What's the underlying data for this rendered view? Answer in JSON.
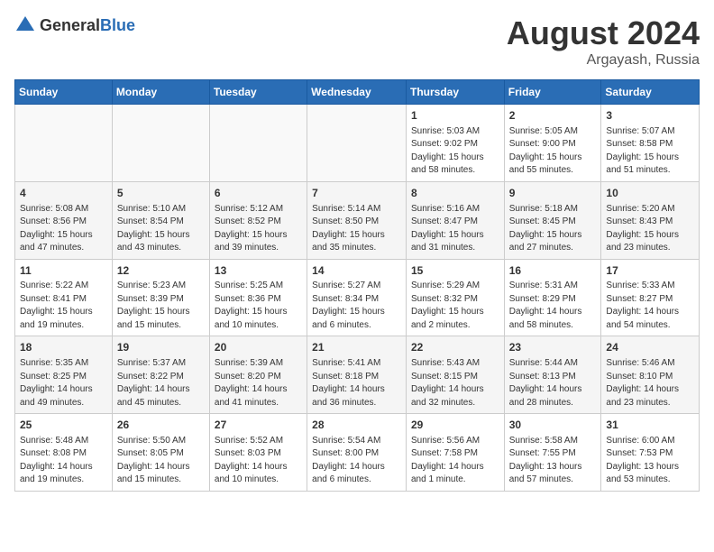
{
  "header": {
    "logo_general": "General",
    "logo_blue": "Blue",
    "month_year": "August 2024",
    "location": "Argayash, Russia"
  },
  "weekdays": [
    "Sunday",
    "Monday",
    "Tuesday",
    "Wednesday",
    "Thursday",
    "Friday",
    "Saturday"
  ],
  "weeks": [
    [
      {
        "day": "",
        "info": ""
      },
      {
        "day": "",
        "info": ""
      },
      {
        "day": "",
        "info": ""
      },
      {
        "day": "",
        "info": ""
      },
      {
        "day": "1",
        "info": "Sunrise: 5:03 AM\nSunset: 9:02 PM\nDaylight: 15 hours\nand 58 minutes."
      },
      {
        "day": "2",
        "info": "Sunrise: 5:05 AM\nSunset: 9:00 PM\nDaylight: 15 hours\nand 55 minutes."
      },
      {
        "day": "3",
        "info": "Sunrise: 5:07 AM\nSunset: 8:58 PM\nDaylight: 15 hours\nand 51 minutes."
      }
    ],
    [
      {
        "day": "4",
        "info": "Sunrise: 5:08 AM\nSunset: 8:56 PM\nDaylight: 15 hours\nand 47 minutes."
      },
      {
        "day": "5",
        "info": "Sunrise: 5:10 AM\nSunset: 8:54 PM\nDaylight: 15 hours\nand 43 minutes."
      },
      {
        "day": "6",
        "info": "Sunrise: 5:12 AM\nSunset: 8:52 PM\nDaylight: 15 hours\nand 39 minutes."
      },
      {
        "day": "7",
        "info": "Sunrise: 5:14 AM\nSunset: 8:50 PM\nDaylight: 15 hours\nand 35 minutes."
      },
      {
        "day": "8",
        "info": "Sunrise: 5:16 AM\nSunset: 8:47 PM\nDaylight: 15 hours\nand 31 minutes."
      },
      {
        "day": "9",
        "info": "Sunrise: 5:18 AM\nSunset: 8:45 PM\nDaylight: 15 hours\nand 27 minutes."
      },
      {
        "day": "10",
        "info": "Sunrise: 5:20 AM\nSunset: 8:43 PM\nDaylight: 15 hours\nand 23 minutes."
      }
    ],
    [
      {
        "day": "11",
        "info": "Sunrise: 5:22 AM\nSunset: 8:41 PM\nDaylight: 15 hours\nand 19 minutes."
      },
      {
        "day": "12",
        "info": "Sunrise: 5:23 AM\nSunset: 8:39 PM\nDaylight: 15 hours\nand 15 minutes."
      },
      {
        "day": "13",
        "info": "Sunrise: 5:25 AM\nSunset: 8:36 PM\nDaylight: 15 hours\nand 10 minutes."
      },
      {
        "day": "14",
        "info": "Sunrise: 5:27 AM\nSunset: 8:34 PM\nDaylight: 15 hours\nand 6 minutes."
      },
      {
        "day": "15",
        "info": "Sunrise: 5:29 AM\nSunset: 8:32 PM\nDaylight: 15 hours\nand 2 minutes."
      },
      {
        "day": "16",
        "info": "Sunrise: 5:31 AM\nSunset: 8:29 PM\nDaylight: 14 hours\nand 58 minutes."
      },
      {
        "day": "17",
        "info": "Sunrise: 5:33 AM\nSunset: 8:27 PM\nDaylight: 14 hours\nand 54 minutes."
      }
    ],
    [
      {
        "day": "18",
        "info": "Sunrise: 5:35 AM\nSunset: 8:25 PM\nDaylight: 14 hours\nand 49 minutes."
      },
      {
        "day": "19",
        "info": "Sunrise: 5:37 AM\nSunset: 8:22 PM\nDaylight: 14 hours\nand 45 minutes."
      },
      {
        "day": "20",
        "info": "Sunrise: 5:39 AM\nSunset: 8:20 PM\nDaylight: 14 hours\nand 41 minutes."
      },
      {
        "day": "21",
        "info": "Sunrise: 5:41 AM\nSunset: 8:18 PM\nDaylight: 14 hours\nand 36 minutes."
      },
      {
        "day": "22",
        "info": "Sunrise: 5:43 AM\nSunset: 8:15 PM\nDaylight: 14 hours\nand 32 minutes."
      },
      {
        "day": "23",
        "info": "Sunrise: 5:44 AM\nSunset: 8:13 PM\nDaylight: 14 hours\nand 28 minutes."
      },
      {
        "day": "24",
        "info": "Sunrise: 5:46 AM\nSunset: 8:10 PM\nDaylight: 14 hours\nand 23 minutes."
      }
    ],
    [
      {
        "day": "25",
        "info": "Sunrise: 5:48 AM\nSunset: 8:08 PM\nDaylight: 14 hours\nand 19 minutes."
      },
      {
        "day": "26",
        "info": "Sunrise: 5:50 AM\nSunset: 8:05 PM\nDaylight: 14 hours\nand 15 minutes."
      },
      {
        "day": "27",
        "info": "Sunrise: 5:52 AM\nSunset: 8:03 PM\nDaylight: 14 hours\nand 10 minutes."
      },
      {
        "day": "28",
        "info": "Sunrise: 5:54 AM\nSunset: 8:00 PM\nDaylight: 14 hours\nand 6 minutes."
      },
      {
        "day": "29",
        "info": "Sunrise: 5:56 AM\nSunset: 7:58 PM\nDaylight: 14 hours\nand 1 minute."
      },
      {
        "day": "30",
        "info": "Sunrise: 5:58 AM\nSunset: 7:55 PM\nDaylight: 13 hours\nand 57 minutes."
      },
      {
        "day": "31",
        "info": "Sunrise: 6:00 AM\nSunset: 7:53 PM\nDaylight: 13 hours\nand 53 minutes."
      }
    ]
  ]
}
